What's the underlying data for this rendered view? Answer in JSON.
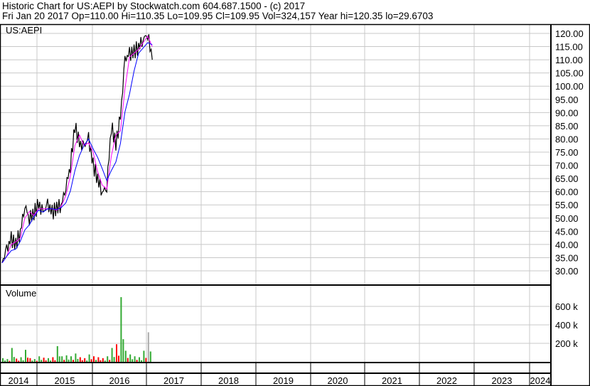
{
  "header": {
    "title": "Historic Chart for US:AEPI by Stockwatch.com 604.687.1500 - (c) 2017",
    "quote": "Fri Jan 20 2017  Op=110.00  Hi=110.35  Lo=109.95  Cl=109.95  Vol=324,157  Year hi=120.35  lo=29.6703"
  },
  "chart_data": {
    "type": "line",
    "title": "US:AEPI",
    "volume_label": "Volume",
    "ylim": [
      27,
      123
    ],
    "price_ticks": [
      "120.00",
      "115.00",
      "110.00",
      "105.00",
      "100.00",
      "95.00",
      "90.00",
      "85.00",
      "80.00",
      "75.00",
      "70.00",
      "65.00",
      "60.00",
      "55.00",
      "50.00",
      "45.00",
      "40.00",
      "35.00",
      "30.00"
    ],
    "volume_ticks": [
      "600 k",
      "400 k",
      "200 k"
    ],
    "years": [
      "2014",
      "2015",
      "2016",
      "2017",
      "2018",
      "2019",
      "2020",
      "2021",
      "2022",
      "2023",
      "2024"
    ],
    "series_start": "2014-04",
    "monthly_close": [
      33,
      38,
      42,
      40,
      45,
      55,
      50,
      52,
      55,
      52,
      55,
      52,
      54,
      55,
      62,
      70,
      85,
      78,
      77,
      80,
      70,
      65,
      60,
      62,
      85,
      78,
      88,
      110,
      112,
      113,
      115,
      118,
      120,
      110
    ],
    "monthly_volume_k": [
      40,
      30,
      150,
      35,
      50,
      130,
      40,
      30,
      60,
      45,
      40,
      50,
      170,
      60,
      70,
      60,
      90,
      50,
      40,
      80,
      60,
      50,
      40,
      60,
      150,
      190,
      700,
      120,
      80,
      60,
      50,
      120,
      320
    ],
    "colors": {
      "price": "#000000",
      "ma_short": "#ff00ff",
      "ma_long": "#0000ff",
      "vol_up": "#33aa33",
      "vol_down": "#ff0000",
      "vol_last": "#aaaaaa"
    }
  }
}
